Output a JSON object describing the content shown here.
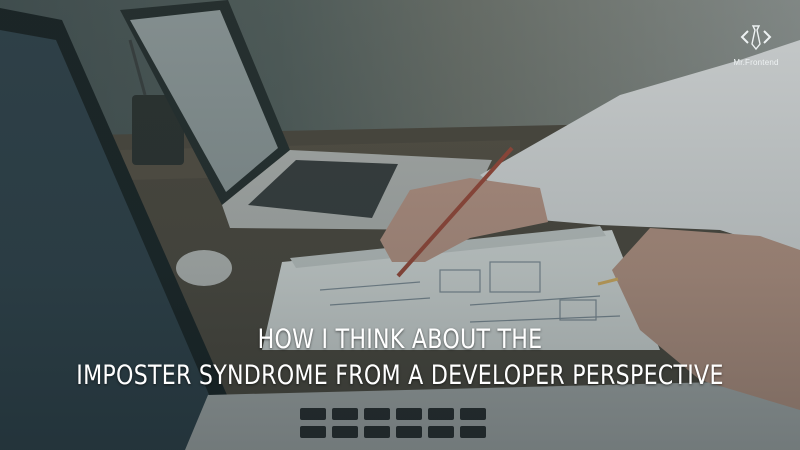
{
  "banner": {
    "headline_line_1": "HOW I THINK ABOUT THE",
    "headline_line_2": "IMPOSTER SYNDROME FROM A DEVELOPER PERSPECTIVE",
    "logo_text": "Mr.Frontend"
  },
  "colors": {
    "headline": "#ffffff",
    "tint": "#1e3a40"
  },
  "icons": [
    "code-brackets-tie-logo-icon"
  ]
}
